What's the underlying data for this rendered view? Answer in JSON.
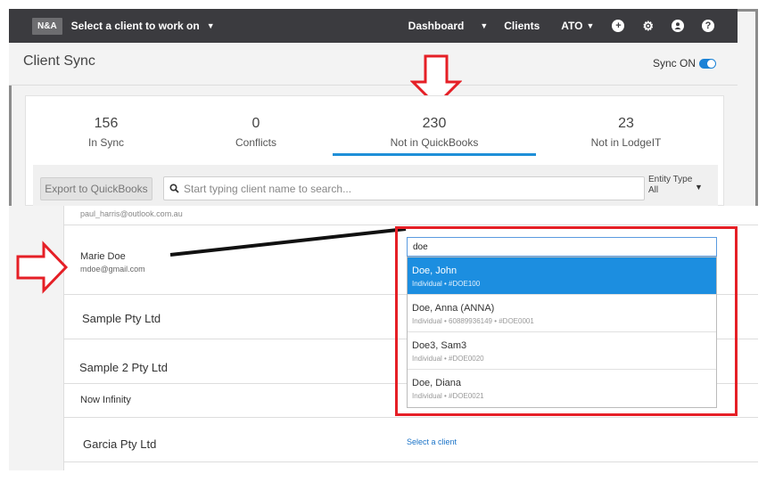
{
  "nav": {
    "logo": "N&A",
    "client_selector": "Select a client to work on",
    "dashboard": "Dashboard",
    "clients": "Clients",
    "ato": "ATO",
    "icons": [
      "plus-circle-icon",
      "gear-icon",
      "user-circle-icon",
      "help-circle-icon"
    ]
  },
  "header": {
    "title": "Client Sync",
    "sync_label": "Sync ON",
    "sync_on": true
  },
  "tabs": [
    {
      "count": "156",
      "label": "In Sync"
    },
    {
      "count": "0",
      "label": "Conflicts"
    },
    {
      "count": "230",
      "label": "Not in QuickBooks",
      "active": true
    },
    {
      "count": "23",
      "label": "Not in LodgeIT"
    }
  ],
  "toolbar": {
    "export_label": "Export to QuickBooks",
    "search_placeholder": "Start typing client name to search...",
    "entity_label": "Entity Type",
    "entity_value": "All"
  },
  "rows": [
    {
      "email_partial": "paul_harris@outlook.com.au"
    },
    {
      "name": "Marie Doe",
      "email": "mdoe@gmail.com"
    },
    {
      "name": "Sample Pty Ltd"
    },
    {
      "name": "Sample 2 Pty Ltd"
    },
    {
      "name": "Now Infinity"
    },
    {
      "name": "Garcia Pty Ltd",
      "action": "Select a client"
    }
  ],
  "dropdown": {
    "query": "doe",
    "options": [
      {
        "title": "Doe, John",
        "sub": "Individual • #DOE100",
        "highlighted": true
      },
      {
        "title": "Doe, Anna (ANNA)",
        "sub": "Individual • 60889936149 • #DOE0001"
      },
      {
        "title": "Doe3, Sam3",
        "sub": "Individual • #DOE0020"
      },
      {
        "title": "Doe, Diana",
        "sub": "Individual • #DOE0021"
      }
    ]
  },
  "colors": {
    "nav_bg": "#3b3b3f",
    "accent": "#1e8fd8",
    "highlight": "#1c8ee0",
    "annotation_red": "#e51f26"
  }
}
